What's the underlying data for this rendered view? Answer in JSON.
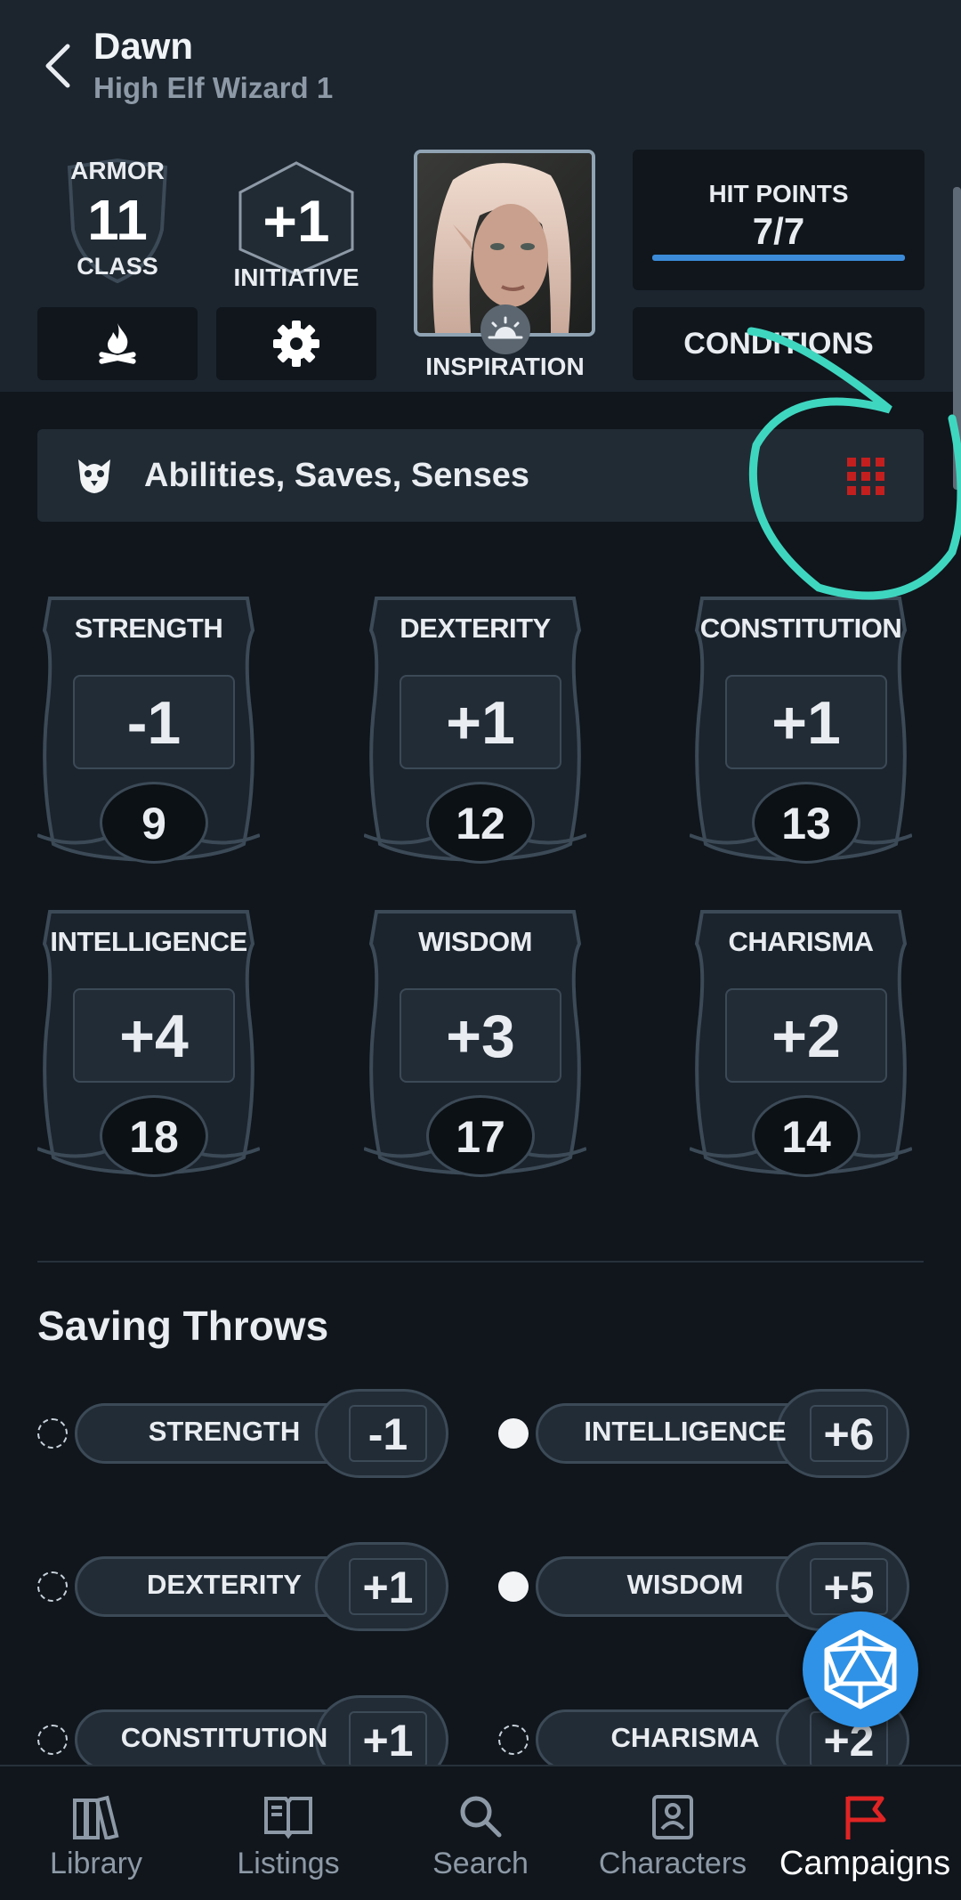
{
  "header": {
    "name": "Dawn",
    "subtitle": "High Elf Wizard 1"
  },
  "armor_class": {
    "label_top": "ARMOR",
    "value": "11",
    "label_bottom": "CLASS"
  },
  "initiative": {
    "value": "+1",
    "label": "INITIATIVE"
  },
  "inspiration": {
    "label": "INSPIRATION"
  },
  "hit_points": {
    "label": "HIT POINTS",
    "value": "7/7",
    "fraction": 1.0,
    "bar_color": "#3b8bd9"
  },
  "conditions": {
    "label": "CONDITIONS"
  },
  "section": {
    "title": "Abilities, Saves, Senses",
    "grid_icon_color": "#c41f1f"
  },
  "abilities": [
    {
      "name": "STRENGTH",
      "mod": "-1",
      "score": "9"
    },
    {
      "name": "DEXTERITY",
      "mod": "+1",
      "score": "12"
    },
    {
      "name": "CONSTITUTION",
      "mod": "+1",
      "score": "13"
    },
    {
      "name": "INTELLIGENCE",
      "mod": "+4",
      "score": "18"
    },
    {
      "name": "WISDOM",
      "mod": "+3",
      "score": "17"
    },
    {
      "name": "CHARISMA",
      "mod": "+2",
      "score": "14"
    }
  ],
  "saving_throws": {
    "title": "Saving Throws",
    "items": [
      {
        "name": "STRENGTH",
        "value": "-1",
        "proficient": false
      },
      {
        "name": "INTELLIGENCE",
        "value": "+6",
        "proficient": true
      },
      {
        "name": "DEXTERITY",
        "value": "+1",
        "proficient": false
      },
      {
        "name": "WISDOM",
        "value": "+5",
        "proficient": true
      },
      {
        "name": "CONSTITUTION",
        "value": "+1",
        "proficient": false
      },
      {
        "name": "CHARISMA",
        "value": "+2",
        "proficient": false
      }
    ]
  },
  "nav": {
    "items": [
      {
        "label": "Library",
        "icon": "library-icon"
      },
      {
        "label": "Listings",
        "icon": "book-icon"
      },
      {
        "label": "Search",
        "icon": "search-icon"
      },
      {
        "label": "Characters",
        "icon": "character-icon"
      },
      {
        "label": "Campaigns",
        "icon": "flag-icon",
        "active": true,
        "color": "#e02424"
      }
    ]
  },
  "colors": {
    "accent_blue": "#2f92e6",
    "annotation_teal": "#3fd6c0"
  }
}
